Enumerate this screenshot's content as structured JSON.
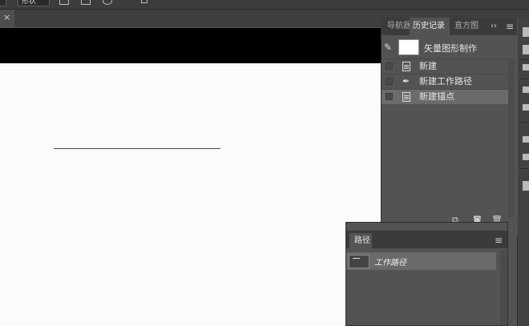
{
  "options_bar": {
    "mode_label": "形状"
  },
  "document_tab": {
    "close_glyph": "×"
  },
  "history_panel": {
    "tabs": [
      {
        "label": "导航器"
      },
      {
        "label": "历史记录"
      },
      {
        "label": "直方图"
      }
    ],
    "active_tab": "历史记录",
    "expand_glyph": "››",
    "menu_glyph": "≡",
    "snapshot": {
      "label": "矢量图形制作"
    },
    "states": [
      {
        "label": "新建",
        "icon": "document-icon",
        "selected": false
      },
      {
        "label": "新建工作路径",
        "icon": "pen-tool-icon",
        "selected": false
      },
      {
        "label": "新建锚点",
        "icon": "document-icon",
        "selected": true
      }
    ],
    "footer_icons": [
      "new-document-from-state-icon",
      "camera-snapshot-icon",
      "trash-icon"
    ]
  },
  "paths_panel": {
    "tab_label": "路径",
    "menu_glyph": "≡",
    "items": [
      {
        "label": "工作路径",
        "selected": true
      }
    ]
  },
  "colors": {
    "panel_bg": "#535353",
    "tab_bar_bg": "#3b3b3b",
    "selected_row": "#6b6b6b",
    "canvas": "#fbfbfb",
    "pasteboard": "#000000"
  }
}
